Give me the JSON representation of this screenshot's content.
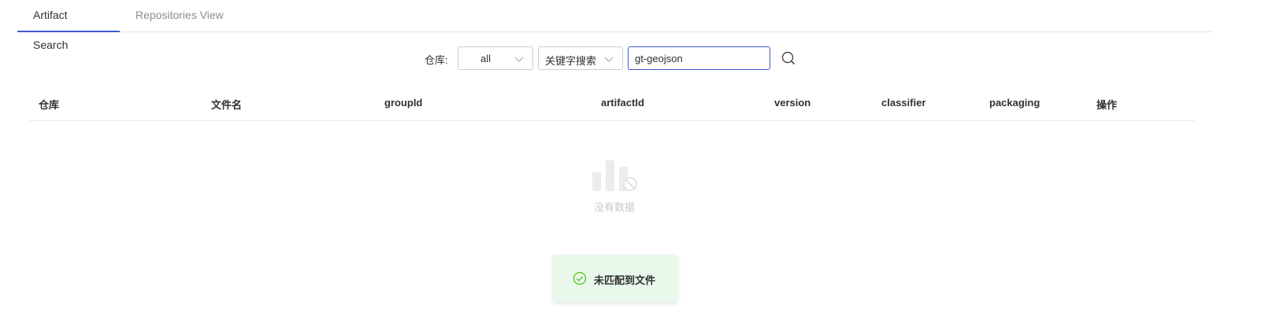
{
  "tabs": [
    {
      "label": "Artifact Search",
      "active": true
    },
    {
      "label": "Repositories View",
      "active": false
    }
  ],
  "search": {
    "repo_label": "仓库:",
    "repo_value": "all",
    "mode_value": "关键字搜索",
    "query": "gt-geojson"
  },
  "table": {
    "columns": [
      "仓库",
      "文件名",
      "groupId",
      "artifactId",
      "version",
      "classifier",
      "packaging",
      "操作"
    ]
  },
  "empty": {
    "text": "没有数据"
  },
  "toast": {
    "message": "未匹配到文件"
  },
  "colors": {
    "accent": "#3f5ad1",
    "toast_bg": "#e8f8ea",
    "success": "#52c41a"
  }
}
